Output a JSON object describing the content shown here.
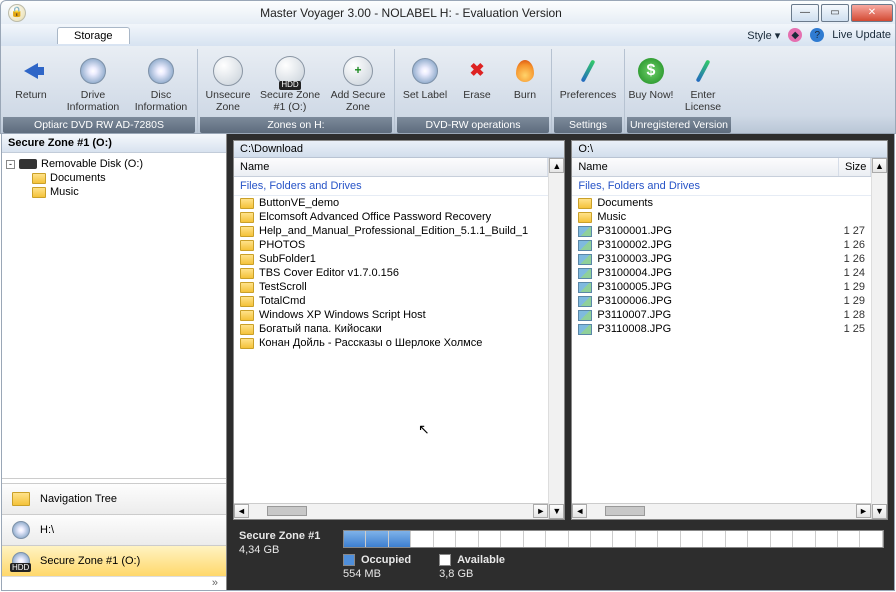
{
  "window": {
    "title": "Master Voyager 3.00 - NOLABEL H: - Evaluation Version"
  },
  "menustrip": {
    "storage_tab": "Storage",
    "style": "Style",
    "live_update": "Live Update"
  },
  "ribbon": {
    "groups": {
      "drive": {
        "label": "Optiarc  DVD RW AD-7280S",
        "return": "Return",
        "drive_info": "Drive Information",
        "disc_info": "Disc Information"
      },
      "zones": {
        "label": "Zones on H:",
        "unsecure": "Unsecure Zone",
        "secure_zone": "Secure Zone #1 (O:)",
        "add_zone": "Add Secure Zone"
      },
      "ops": {
        "label": "DVD-RW operations",
        "set_label": "Set Label",
        "erase": "Erase",
        "burn": "Burn"
      },
      "settings": {
        "label": "Settings",
        "prefs": "Preferences"
      },
      "unreg": {
        "label": "Unregistered Version",
        "buy": "Buy Now!",
        "enter": "Enter License"
      }
    }
  },
  "left": {
    "header": "Secure Zone #1 (O:)",
    "root": "Removable Disk (O:)",
    "children": [
      "Documents",
      "Music"
    ],
    "nav": {
      "tree": "Navigation Tree",
      "h": "H:\\",
      "secure": "Secure Zone #1 (O:)"
    }
  },
  "panes": {
    "left": {
      "path": "C:\\Download",
      "col_name": "Name",
      "section": "Files, Folders and Drives",
      "items": [
        "ButtonVE_demo",
        "Elcomsoft Advanced Office Password Recovery",
        "Help_and_Manual_Professional_Edition_5.1.1_Build_1",
        "PHOTOS",
        "SubFolder1",
        "TBS Cover Editor v1.7.0.156",
        "TestScroll",
        "TotalCmd",
        "Windows XP Windows Script Host",
        "Богатый папа. Кийосаки",
        "Конан Дойль - Рассказы о Шерлоке Холмсе"
      ]
    },
    "right": {
      "path": "O:\\",
      "col_name": "Name",
      "col_size": "Size",
      "section": "Files, Folders and Drives",
      "folders": [
        "Documents",
        "Music"
      ],
      "files": [
        {
          "name": "P3100001.JPG",
          "size": "1 27"
        },
        {
          "name": "P3100002.JPG",
          "size": "1 26"
        },
        {
          "name": "P3100003.JPG",
          "size": "1 26"
        },
        {
          "name": "P3100004.JPG",
          "size": "1 24"
        },
        {
          "name": "P3100005.JPG",
          "size": "1 29"
        },
        {
          "name": "P3100006.JPG",
          "size": "1 29"
        },
        {
          "name": "P3110007.JPG",
          "size": "1 28"
        },
        {
          "name": "P3110008.JPG",
          "size": "1 25"
        }
      ]
    }
  },
  "usage": {
    "title": "Secure Zone #1",
    "total": "4,34 GB",
    "occupied_label": "Occupied",
    "occupied": "554 MB",
    "available_label": "Available",
    "available": "3,8 GB",
    "segments_total": 24,
    "segments_occupied": 3
  }
}
